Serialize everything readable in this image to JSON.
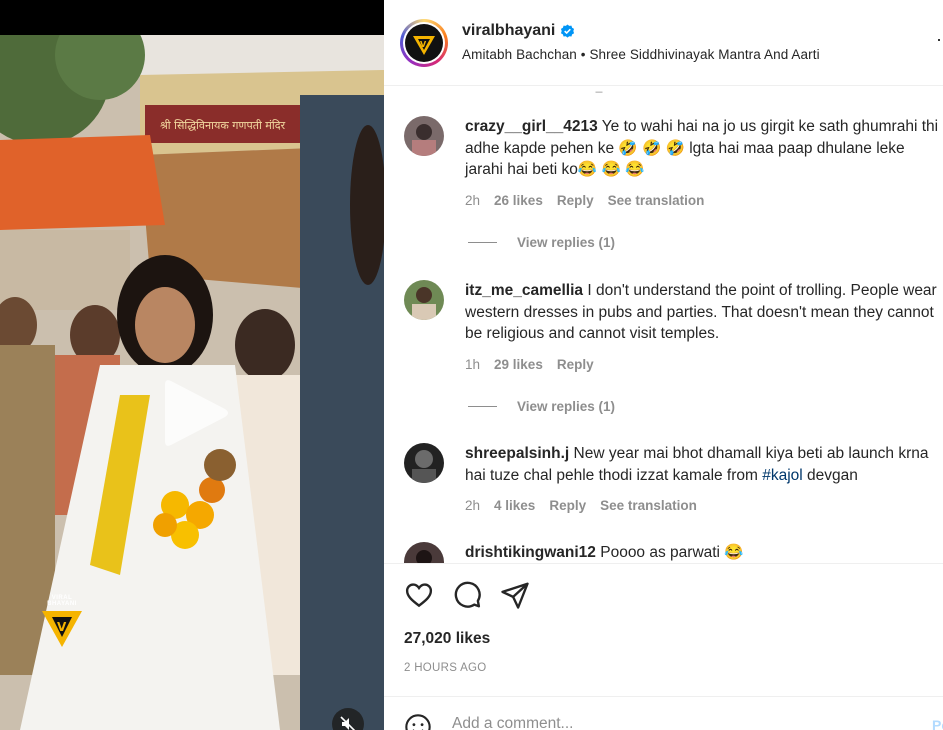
{
  "post": {
    "username": "viralbhayani",
    "audio": "Amitabh Bachchan • Shree Siddhivinayak Mantra And Aarti",
    "avatar_logo": "VIRALBHAYANI",
    "more_icon": "more-dots-icon"
  },
  "video": {
    "temple_sign": "श्री सिद्धिविनायक गणपती मंदिर",
    "watermark": "VIRAL BHAYANI",
    "play_icon": "play-icon",
    "mute_icon": "muted-speaker-icon"
  },
  "comments": [
    {
      "user": "crazy__girl__4213",
      "text": "Ye to wahi hai na jo us girgit ke sath ghumrahi thi adhe kapde pehen ke 🤣 🤣 🤣 lgta hai maa paap dhulane leke jarahi hai beti ko😂 😂 😂",
      "time": "2h",
      "likes": "26 likes",
      "reply": "Reply",
      "translate": "See translation",
      "view_replies": "View replies (1)"
    },
    {
      "user": "itz_me_camellia",
      "text": "I don't understand the point of trolling. People wear western dresses in pubs and parties. That doesn't mean they cannot be religious and cannot visit temples.",
      "time": "1h",
      "likes": "29 likes",
      "reply": "Reply",
      "view_replies": "View replies (1)"
    },
    {
      "user": "shreepalsinh.j",
      "text_before": "New year mai bhot dhamall kiya beti ab launch krna hai tuze chal pehle thodi izzat kamale from ",
      "hashtag": "#kajol",
      "text_after": " devgan",
      "time": "2h",
      "likes": "4 likes",
      "reply": "Reply",
      "translate": "See translation"
    },
    {
      "user": "drishtikingwani12",
      "text": "Poooo as parwati 😂"
    }
  ],
  "actions": {
    "like_icon": "heart-icon",
    "comment_icon": "comment-icon",
    "share_icon": "share-icon",
    "likes": "27,020 likes",
    "timestamp": "2 HOURS AGO"
  },
  "add_comment": {
    "placeholder": "Add a comment...",
    "post_label": "Post",
    "emoji_icon": "emoji-icon"
  }
}
